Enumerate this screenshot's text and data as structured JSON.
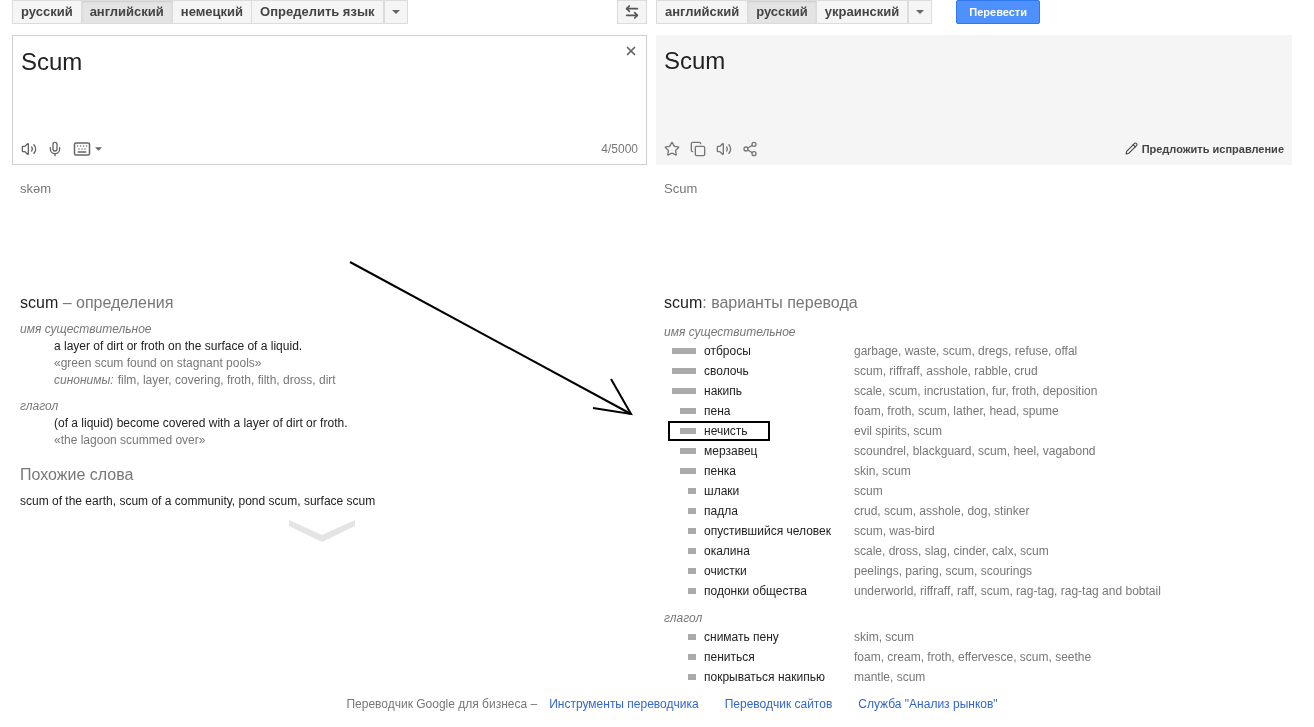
{
  "source": {
    "languages": [
      {
        "label": "русский",
        "selected": false
      },
      {
        "label": "английский",
        "selected": true
      },
      {
        "label": "немецкий",
        "selected": false
      },
      {
        "label": "Определить язык",
        "selected": false
      }
    ],
    "text": "Scum",
    "char_count": "4/5000",
    "phonetic": "skəm"
  },
  "target": {
    "languages": [
      {
        "label": "английский",
        "selected": false
      },
      {
        "label": "русский",
        "selected": true
      },
      {
        "label": "украинский",
        "selected": false
      }
    ],
    "translate_button": "Перевести",
    "text": "Scum",
    "suggest_edit": "Предложить исправление",
    "transliteration": "Scum"
  },
  "definitions": {
    "word": "scum",
    "title": " – определения",
    "groups": [
      {
        "pos": "имя существительное",
        "entries": [
          {
            "definition": "a layer of dirt or froth on the surface of a liquid.",
            "example": "«green scum found on stagnant pools»",
            "synonyms_label": "синонимы:",
            "synonyms": "film, layer, covering, froth, filth, dross, dirt"
          }
        ]
      },
      {
        "pos": "глагол",
        "entries": [
          {
            "definition": "(of a liquid) become covered with a layer of dirt or froth.",
            "example": "«the lagoon scummed over»"
          }
        ]
      }
    ]
  },
  "related": {
    "title": "Похожие слова",
    "words": "scum of the earth, scum of a community, pond scum, surface scum"
  },
  "translations": {
    "word": "scum",
    "title": ": варианты перевода",
    "groups": [
      {
        "pos": "имя существительное",
        "rows": [
          {
            "word": "отбросы",
            "kind": "common",
            "meanings": "garbage, waste, scum, dregs, refuse, offal",
            "annotated": false
          },
          {
            "word": "сволочь",
            "kind": "common",
            "meanings": "scum, riffraff, asshole, rabble, crud",
            "annotated": false
          },
          {
            "word": "накипь",
            "kind": "common",
            "meanings": "scale, scum, incrustation, fur, froth, deposition",
            "annotated": false
          },
          {
            "word": "пена",
            "kind": "uncommon",
            "meanings": "foam, froth, scum, lather, head, spume",
            "annotated": false
          },
          {
            "word": "нечисть",
            "kind": "uncommon",
            "meanings": "evil spirits, scum",
            "annotated": true
          },
          {
            "word": "мерзавец",
            "kind": "uncommon",
            "meanings": "scoundrel, blackguard, scum, heel, vagabond",
            "annotated": false
          },
          {
            "word": "пенка",
            "kind": "uncommon",
            "meanings": "skin, scum",
            "annotated": false
          },
          {
            "word": "шлаки",
            "kind": "rare",
            "meanings": "scum",
            "annotated": false
          },
          {
            "word": "падла",
            "kind": "rare",
            "meanings": "crud, scum, asshole, dog, stinker",
            "annotated": false
          },
          {
            "word": "опустившийся человек",
            "kind": "rare",
            "meanings": "scum, was-bird",
            "annotated": false
          },
          {
            "word": "окалина",
            "kind": "rare",
            "meanings": "scale, dross, slag, cinder, calx, scum",
            "annotated": false
          },
          {
            "word": "очистки",
            "kind": "rare",
            "meanings": "peelings, paring, scum, scourings",
            "annotated": false
          },
          {
            "word": "подонки общества",
            "kind": "rare",
            "meanings": "underworld, riffraff, raff, scum, rag-tag, rag-tag and bobtail",
            "annotated": false
          }
        ]
      },
      {
        "pos": "глагол",
        "rows": [
          {
            "word": "снимать пену",
            "kind": "rare",
            "meanings": "skim, scum",
            "annotated": false
          },
          {
            "word": "пениться",
            "kind": "rare",
            "meanings": "foam, cream, froth, effervesce, scum, seethe",
            "annotated": false
          },
          {
            "word": "покрываться накипью",
            "kind": "rare",
            "meanings": "mantle, scum",
            "annotated": false
          }
        ]
      }
    ]
  },
  "footer": {
    "prefix": "Переводчик Google для бизнеса –",
    "links": [
      "Инструменты переводчика",
      "Переводчик сайтов",
      "Служба \"Анализ рынков\""
    ]
  }
}
